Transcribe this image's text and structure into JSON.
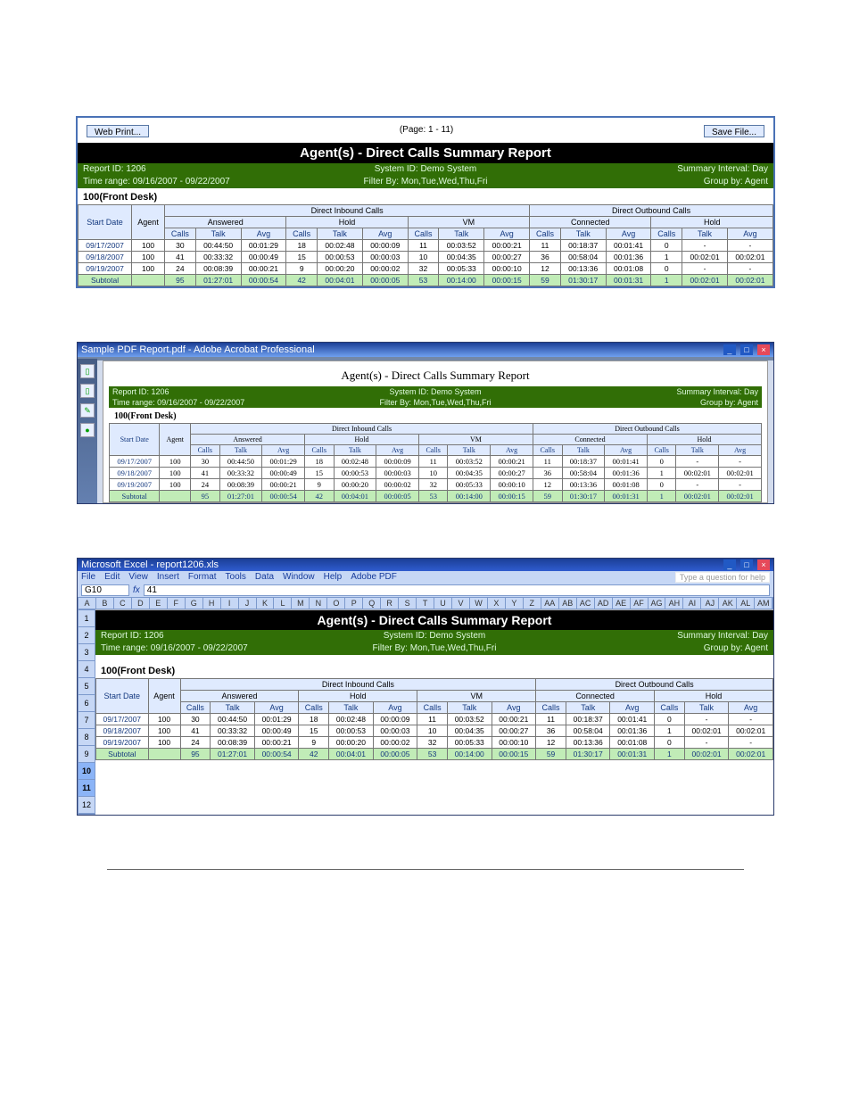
{
  "report": {
    "title": "Agent(s) - Direct Calls Summary Report",
    "report_id_label": "Report ID: 1206",
    "time_range_label": "Time range: 09/16/2007 - 09/22/2007",
    "system_id_label": "System ID: Demo System",
    "filter_label": "Filter By: Mon,Tue,Wed,Thu,Fri",
    "summary_label": "Summary Interval: Day",
    "group_label": "Group by: Agent",
    "desk_header": "100(Front Desk)",
    "col_groups": {
      "inbound": "Direct Inbound Calls",
      "outbound": "Direct Outbound Calls",
      "answered": "Answered",
      "hold": "Hold",
      "vm": "VM",
      "connected": "Connected",
      "hold2": "Hold"
    },
    "col_heads": {
      "start": "Start Date",
      "agent": "Agent",
      "calls": "Calls",
      "talk": "Talk",
      "avg": "Avg"
    },
    "rows": [
      {
        "date": "09/17/2007",
        "agent": "100",
        "ans_c": "30",
        "ans_t": "00:44:50",
        "ans_a": "00:01:29",
        "h_c": "18",
        "h_t": "00:02:48",
        "h_a": "00:00:09",
        "vm_c": "11",
        "vm_t": "00:03:52",
        "vm_a": "00:00:21",
        "con_c": "11",
        "con_t": "00:18:37",
        "con_a": "00:01:41",
        "oh_c": "0",
        "oh_t": "-",
        "oh_a": "-"
      },
      {
        "date": "09/18/2007",
        "agent": "100",
        "ans_c": "41",
        "ans_t": "00:33:32",
        "ans_a": "00:00:49",
        "h_c": "15",
        "h_t": "00:00:53",
        "h_a": "00:00:03",
        "vm_c": "10",
        "vm_t": "00:04:35",
        "vm_a": "00:00:27",
        "con_c": "36",
        "con_t": "00:58:04",
        "con_a": "00:01:36",
        "oh_c": "1",
        "oh_t": "00:02:01",
        "oh_a": "00:02:01"
      },
      {
        "date": "09/19/2007",
        "agent": "100",
        "ans_c": "24",
        "ans_t": "00:08:39",
        "ans_a": "00:00:21",
        "h_c": "9",
        "h_t": "00:00:20",
        "h_a": "00:00:02",
        "vm_c": "32",
        "vm_t": "00:05:33",
        "vm_a": "00:00:10",
        "con_c": "12",
        "con_t": "00:13:36",
        "con_a": "00:01:08",
        "oh_c": "0",
        "oh_t": "-",
        "oh_a": "-"
      }
    ],
    "subtotal": {
      "label": "Subtotal",
      "ans_c": "95",
      "ans_t": "01:27:01",
      "ans_a": "00:00:54",
      "h_c": "42",
      "h_t": "00:04:01",
      "h_a": "00:00:05",
      "vm_c": "53",
      "vm_t": "00:14:00",
      "vm_a": "00:00:15",
      "con_c": "59",
      "con_t": "01:30:17",
      "con_a": "00:01:31",
      "oh_c": "1",
      "oh_t": "00:02:01",
      "oh_a": "00:02:01"
    }
  },
  "shot1": {
    "web_print": "Web Print...",
    "page_label": "(Page: 1 - 11)",
    "save_file": "Save File..."
  },
  "shot2": {
    "window_title": "Sample PDF Report.pdf - Adobe Acrobat Professional"
  },
  "shot3": {
    "window_title": "Microsoft Excel - report1206.xls",
    "menu": [
      "File",
      "Edit",
      "View",
      "Insert",
      "Format",
      "Tools",
      "Data",
      "Window",
      "Help",
      "Adobe PDF"
    ],
    "help_prompt": "Type a question for help",
    "namebox": "G10",
    "fxicon": "fx",
    "fxval": "41",
    "cols": [
      "A",
      "B",
      "C",
      "D",
      "E",
      "F",
      "G",
      "H",
      "I",
      "J",
      "K",
      "L",
      "M",
      "N",
      "O",
      "P",
      "Q",
      "R",
      "S",
      "T",
      "U",
      "V",
      "W",
      "X",
      "Y",
      "Z",
      "AA",
      "AB",
      "AC",
      "AD",
      "AE",
      "AF",
      "AG",
      "AH",
      "AI",
      "AJ",
      "AK",
      "AL",
      "AM"
    ],
    "rownums": [
      "1",
      "2",
      "3",
      "4",
      "5",
      "6",
      "7",
      "8",
      "9",
      "10",
      "11",
      "12"
    ]
  }
}
